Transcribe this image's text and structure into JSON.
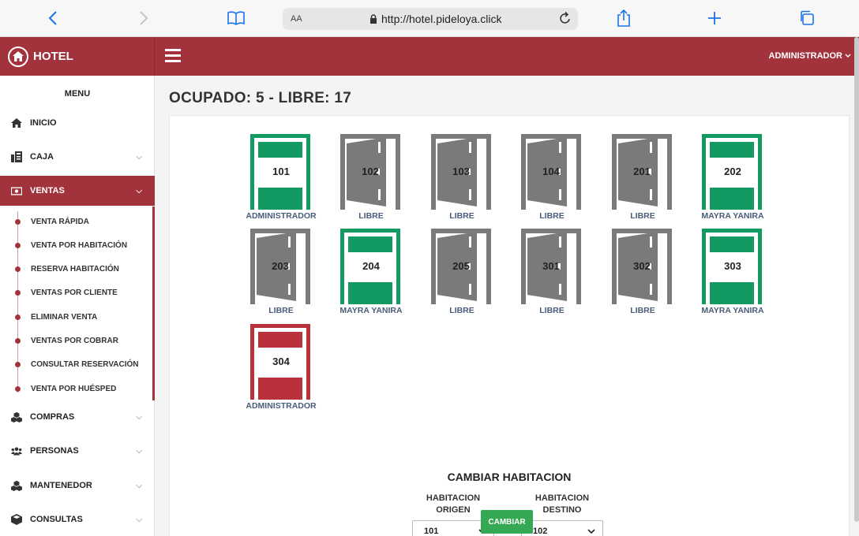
{
  "browser": {
    "url": "http://hotel.pideloya.click",
    "reader_label": "AA"
  },
  "header": {
    "brand": "HOTEL",
    "user_menu": "ADMINISTRADOR"
  },
  "sidebar": {
    "title": "MENU",
    "items": [
      {
        "label": "INICIO",
        "icon": "home-icon"
      },
      {
        "label": "CAJA",
        "icon": "cash-register-icon"
      },
      {
        "label": "VENTAS",
        "icon": "money-icon"
      },
      {
        "label": "COMPRAS",
        "icon": "cubes-icon"
      },
      {
        "label": "PERSONAS",
        "icon": "users-icon"
      },
      {
        "label": "MANTENEDOR",
        "icon": "cubes-icon"
      },
      {
        "label": "CONSULTAS",
        "icon": "cube-icon"
      }
    ],
    "ventas_subitems": [
      "VENTA RÁPIDA",
      "VENTA POR HABITACIÓN",
      "RESERVA HABITACIÓN",
      "VENTAS POR CLIENTE",
      "ELIMINAR VENTA",
      "VENTAS POR COBRAR",
      "CONSULTAR RESERVACIÓN",
      "VENTA POR HUÉSPED"
    ]
  },
  "main": {
    "title": "OCUPADO: 5 - LIBRE: 17",
    "rooms": [
      {
        "number": "101",
        "status": "occupied",
        "color": "#129a62",
        "caption": "ADMINISTRADOR"
      },
      {
        "number": "102",
        "status": "free",
        "caption": "LIBRE"
      },
      {
        "number": "103",
        "status": "free",
        "caption": "LIBRE"
      },
      {
        "number": "104",
        "status": "free",
        "caption": "LIBRE"
      },
      {
        "number": "201",
        "status": "free",
        "caption": "LIBRE"
      },
      {
        "number": "202",
        "status": "occupied",
        "color": "#129a62",
        "caption": "MAYRA YANIRA"
      },
      {
        "number": "203",
        "status": "free",
        "caption": "LIBRE"
      },
      {
        "number": "204",
        "status": "occupied",
        "color": "#129a62",
        "caption": "MAYRA YANIRA"
      },
      {
        "number": "205",
        "status": "free",
        "caption": "LIBRE"
      },
      {
        "number": "301",
        "status": "free",
        "caption": "LIBRE"
      },
      {
        "number": "302",
        "status": "free",
        "caption": "LIBRE"
      },
      {
        "number": "303",
        "status": "occupied",
        "color": "#129a62",
        "caption": "MAYRA YANIRA"
      },
      {
        "number": "304",
        "status": "occupied",
        "color": "#b9313a",
        "caption": "ADMINISTRADOR"
      }
    ],
    "change_room": {
      "title": "CAMBIAR HABITACION",
      "origin_label": "HABITACION ORIGEN",
      "destination_label": "HABITACION DESTINO",
      "origin_value": "101",
      "destination_value": "102",
      "button_label": "CAMBIAR"
    }
  },
  "colors": {
    "primary": "#a2333d",
    "occupied_green": "#129a62",
    "occupied_red": "#b9313a",
    "free_gray": "#7a7a7a",
    "button_green": "#34a853"
  }
}
